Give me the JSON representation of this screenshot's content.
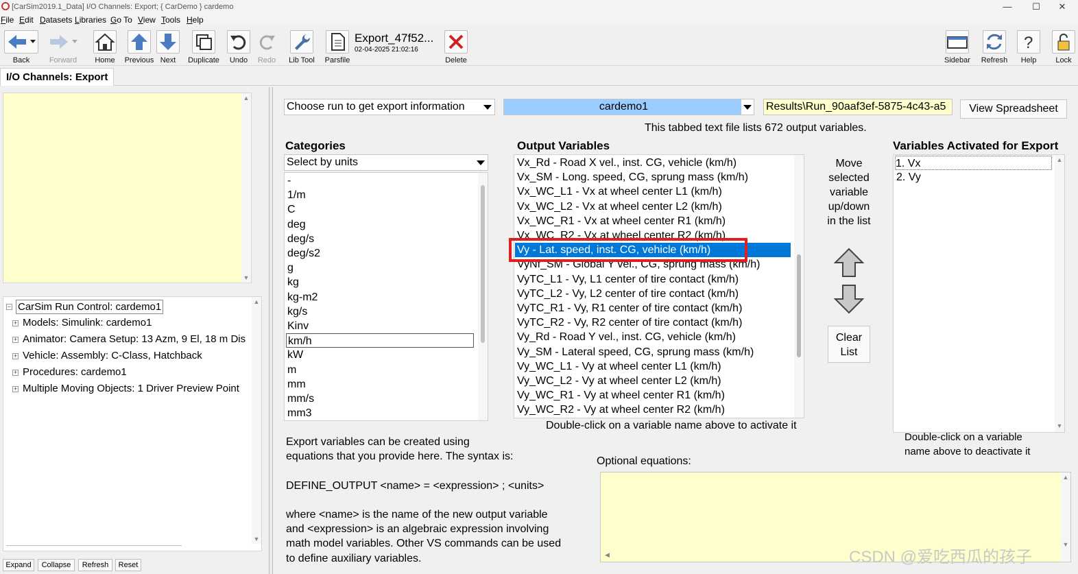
{
  "window": {
    "title": "[CarSim2019.1_Data] I/O Channels: Export; { CarDemo } cardemo",
    "controls": [
      "—",
      "☐",
      "✕"
    ]
  },
  "menu": [
    "File",
    "Edit",
    "Datasets",
    "Libraries",
    "Go To",
    "View",
    "Tools",
    "Help"
  ],
  "toolbar": {
    "back": "Back",
    "forward": "Forward",
    "home": "Home",
    "previous": "Previous",
    "next": "Next",
    "duplicate": "Duplicate",
    "undo": "Undo",
    "redo": "Redo",
    "libtool": "Lib Tool",
    "parsfile": "Parsfile",
    "dataset_title": "Export_47f52...",
    "dataset_date": "02-04-2025 21:02:16",
    "delete": "Delete",
    "sidebar": "Sidebar",
    "refresh": "Refresh",
    "help": "Help",
    "lock": "Lock"
  },
  "tab": "I/O Channels: Export",
  "tree": {
    "root": "CarSim Run Control: cardemo1",
    "items": [
      "Models: Simulink: cardemo1",
      "Animator: Camera Setup: 13 Azm, 9 El, 18 m Dis",
      "Vehicle: Assembly: C-Class, Hatchback",
      "Procedures: cardemo1",
      "Multiple Moving Objects: 1 Driver Preview Point"
    ],
    "buttons": [
      "Expand",
      "Collapse",
      "Refresh",
      "Reset"
    ]
  },
  "run_selector": {
    "label": "Choose run to get export information",
    "run": "cardemo1",
    "path": "Results\\Run_90aaf3ef-5875-4c43-a5",
    "view_button": "View Spreadsheet",
    "info": "This tabbed text file lists 672 output variables."
  },
  "categories": {
    "heading": "Categories",
    "selector": "Select by units",
    "items": [
      "-",
      "1/m",
      "C",
      "deg",
      "deg/s",
      "deg/s2",
      "g",
      "kg",
      "kg-m2",
      "kg/s",
      "Kinv",
      "km/h",
      "kW",
      "m",
      "mm",
      "mm/s",
      "mm3"
    ],
    "selected": "km/h"
  },
  "output_variables": {
    "heading": "Output Variables",
    "items": [
      "Vx_Rd - Road X vel., inst. CG, vehicle (km/h)",
      "Vx_SM - Long. speed, CG, sprung mass (km/h)",
      "Vx_WC_L1 - Vx at wheel center L1 (km/h)",
      "Vx_WC_L2 - Vx at wheel center L2 (km/h)",
      "Vx_WC_R1 - Vx at wheel center R1 (km/h)",
      "Vx_WC_R2 - Vx at wheel center R2 (km/h)",
      "Vy - Lat. speed, inst. CG, vehicle (km/h)",
      "VyNf_SM - Global Y vel., CG, sprung mass (km/h)",
      "VyTC_L1 - Vy, L1 center of tire contact (km/h)",
      "VyTC_L2 - Vy, L2 center of tire contact (km/h)",
      "VyTC_R1 - Vy, R1 center of tire contact (km/h)",
      "VyTC_R2 - Vy, R2 center of tire contact (km/h)",
      "Vy_Rd - Road Y vel., inst. CG, vehicle (km/h)",
      "Vy_SM - Lateral speed, CG, sprung mass (km/h)",
      "Vy_WC_L1 - Vy at wheel center L1 (km/h)",
      "Vy_WC_L2 - Vy at wheel center L2 (km/h)",
      "Vy_WC_R1 - Vy at wheel center R1 (km/h)",
      "Vy_WC_R2 - Vy at wheel center R2 (km/h)"
    ],
    "selected": "Vy - Lat. speed, inst. CG, vehicle (km/h)",
    "hint": "Double-click on a variable name above to activate it"
  },
  "move_panel": {
    "text": [
      "Move",
      "selected",
      "variable",
      "up/down",
      "in the list"
    ],
    "clear_button": [
      "Clear",
      "List"
    ]
  },
  "activated": {
    "heading": "Variables Activated for Export",
    "items": [
      "1. Vx",
      "2. Vy"
    ],
    "hint": [
      "Double-click on a variable",
      "name above to deactivate it"
    ]
  },
  "equations_help": [
    "Export variables can be created using",
    "equations that you provide here. The syntax is:",
    "",
    "DEFINE_OUTPUT <name> = <expression> ; <units>",
    "",
    "where <name> is the name of the new output variable",
    "and <expression> is an algebraic expression involving",
    "math model variables. Other VS commands can be used",
    "to define auxiliary variables."
  ],
  "optional_equations_label": "Optional equations:",
  "watermark": "CSDN @爱吃西瓜的孩子",
  "colors": {
    "selection": "#0078d7",
    "notes_bg": "#ffffcc",
    "run_bg": "#99ccff",
    "highlight": "#e02020"
  }
}
